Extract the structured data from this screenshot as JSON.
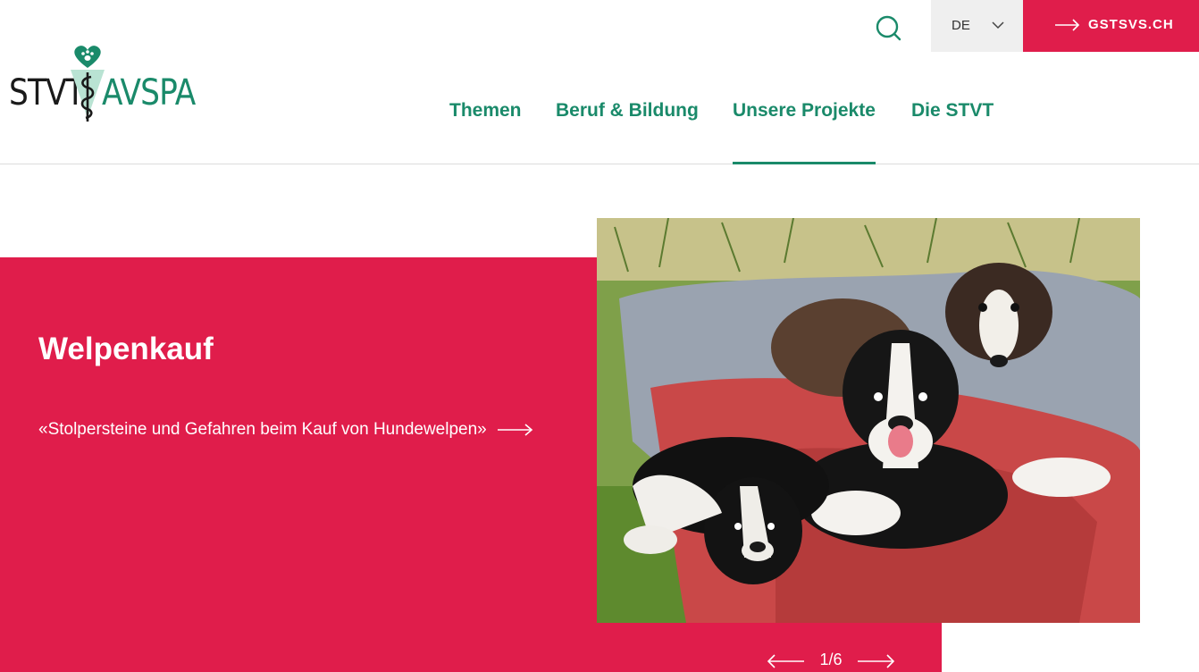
{
  "logo": {
    "left_text": "STVT",
    "right_text": "AVSPA"
  },
  "header": {
    "language": "DE",
    "external_link": "GSTSVS.CH"
  },
  "nav": {
    "items": [
      "Themen",
      "Beruf & Bildung",
      "Unsere Projekte",
      "Die STVT"
    ],
    "active": "Unsere Projekte"
  },
  "hero": {
    "title": "Welpenkauf",
    "link_text": "«Stolpersteine und Gefahren beim Kauf von Hundewelpen»",
    "image_alt": "puppies-on-blanket-photo"
  },
  "slider": {
    "counter": "1/6"
  },
  "colors": {
    "brand_red": "#e01d4b",
    "brand_green": "#1a8a6a",
    "lang_bg": "#efefef"
  },
  "icons": [
    "search-icon",
    "chevron-down-icon",
    "arrow-right-icon",
    "arrow-left-icon",
    "heart-paw-icon",
    "aesculapian-staff-icon"
  ]
}
